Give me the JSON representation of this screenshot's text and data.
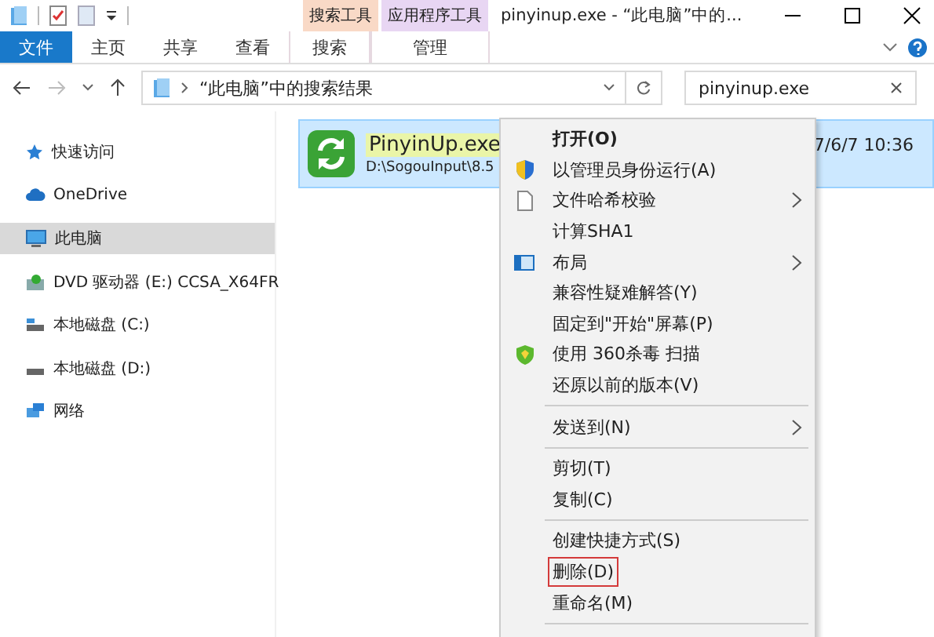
{
  "window": {
    "title": "pinyinup.exe - “此电脑”中的..."
  },
  "context_tabs": [
    {
      "group": "搜索工具",
      "tab": "搜索",
      "color": "#f9d9c6"
    },
    {
      "group": "应用程序工具",
      "tab": "管理",
      "color": "#e8d6f3"
    }
  ],
  "ribbon_tabs": [
    {
      "label": "文件",
      "selected": true
    },
    {
      "label": "主页",
      "selected": false
    },
    {
      "label": "共享",
      "selected": false
    },
    {
      "label": "查看",
      "selected": false
    }
  ],
  "address": {
    "path": "“此电脑”中的搜索结果",
    "search": "pinyinup.exe"
  },
  "nav_items": [
    {
      "label": "快速访问",
      "selected": false
    },
    {
      "label": "OneDrive",
      "selected": false
    },
    {
      "label": "此电脑",
      "selected": true
    },
    {
      "label": "DVD 驱动器 (E:) CCSA_X64FR",
      "selected": false
    },
    {
      "label": "本地磁盘 (C:)",
      "selected": false
    },
    {
      "label": "本地磁盘 (D:)",
      "selected": false
    },
    {
      "label": "网络",
      "selected": false
    }
  ],
  "file": {
    "name": "PinyinUp.exe",
    "path": "D:\\SogouInput\\8.5",
    "date": "7/6/7 10:36",
    "selected": true
  },
  "context_menu": [
    {
      "kind": "item",
      "label": "打开(O)",
      "default": true,
      "marked": false
    },
    {
      "kind": "item",
      "label": "以管理员身份运行(A)",
      "default": false,
      "marked": false
    },
    {
      "kind": "submenu",
      "label": "文件哈希校验",
      "default": false,
      "marked": false
    },
    {
      "kind": "item",
      "label": "计算SHA1",
      "default": false,
      "marked": false
    },
    {
      "kind": "submenu",
      "label": "布局",
      "default": false,
      "marked": false
    },
    {
      "kind": "item",
      "label": "兼容性疑难解答(Y)",
      "default": false,
      "marked": false
    },
    {
      "kind": "item",
      "label": "固定到\"开始\"屏幕(P)",
      "default": false,
      "marked": false
    },
    {
      "kind": "item",
      "label": "使用 360杀毒 扫描",
      "default": false,
      "marked": false
    },
    {
      "kind": "item",
      "label": "还原以前的版本(V)",
      "default": false,
      "marked": false
    },
    {
      "kind": "separator"
    },
    {
      "kind": "submenu",
      "label": "发送到(N)",
      "default": false,
      "marked": false
    },
    {
      "kind": "separator"
    },
    {
      "kind": "item",
      "label": "剪切(T)",
      "default": false,
      "marked": false
    },
    {
      "kind": "item",
      "label": "复制(C)",
      "default": false,
      "marked": false
    },
    {
      "kind": "separator"
    },
    {
      "kind": "item",
      "label": "创建快捷方式(S)",
      "default": false,
      "marked": false
    },
    {
      "kind": "item",
      "label": "删除(D)",
      "default": false,
      "marked": true
    },
    {
      "kind": "item",
      "label": "重命名(M)",
      "default": false,
      "marked": false
    },
    {
      "kind": "separator"
    }
  ]
}
